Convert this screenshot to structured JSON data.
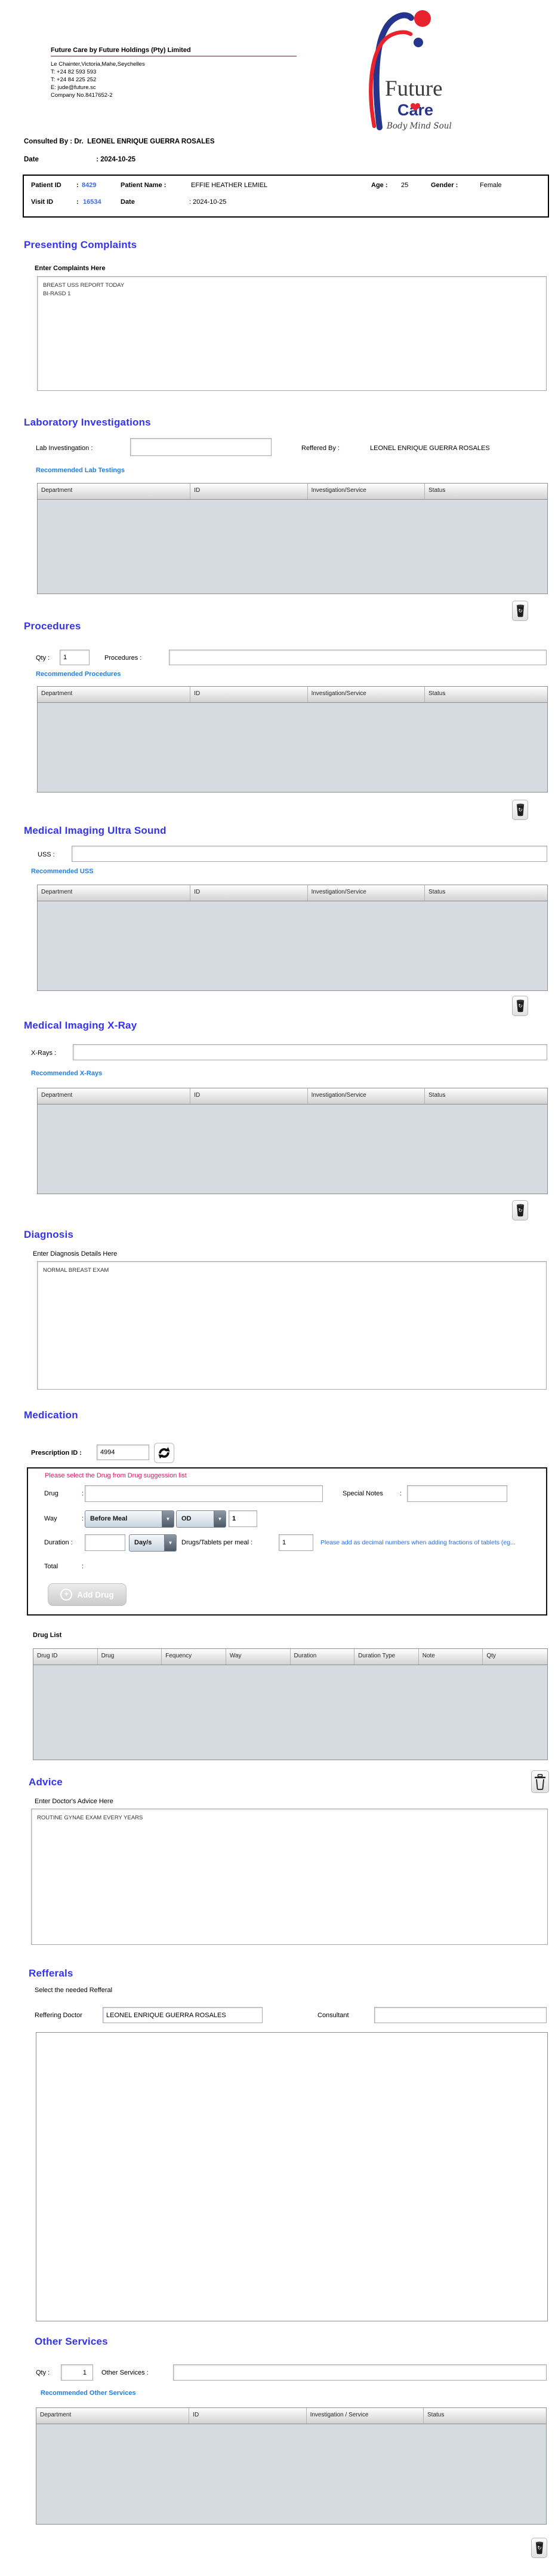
{
  "letterhead": {
    "company_title": "Future Care by Future Holdings (Pty) Limited",
    "address": "Le Chainter,Victoria,Mahe,Seychelles",
    "phone1": "T: +24  82 593 593",
    "phone2": "T: +24  84 225 252",
    "email": "E: jude@future.sc",
    "company_no": "Company No.8417652-2",
    "logo": {
      "word1": "Future",
      "word2": "Care",
      "tagline": "Body Mind Soul"
    }
  },
  "consultation": {
    "consulted_by_label": "Consulted By  :  Dr.",
    "consulted_by_name": "LEONEL ENRIQUE GUERRA ROSALES",
    "date_label": "Date",
    "date_value": ": 2024-10-25"
  },
  "patient": {
    "patient_id_label": "Patient ID",
    "colon": ":",
    "patient_id": "8429",
    "patient_name_label": "Patient Name :",
    "patient_name": "EFFIE HEATHER LEMIEL",
    "age_label": "Age :",
    "age": "25",
    "gender_label": "Gender  :",
    "gender": "Female",
    "visit_id_label": "Visit ID",
    "visit_id": "16534",
    "visit_date_label": "Date",
    "visit_date": ": 2024-10-25"
  },
  "presenting": {
    "title": "Presenting Complaints",
    "input_label": "Enter Complaints Here",
    "value": "BREAST USS REPORT TODAY\nBI-RASD 1"
  },
  "lab": {
    "title": "Laboratory  Investigations",
    "field_label": "Lab Investingation :",
    "referred_by_label": "Reffered By :",
    "referred_by": "LEONEL ENRIQUE GUERRA ROSALES",
    "link": "Recommended Lab Testings",
    "headers": [
      "Department",
      "ID",
      "Investigation/Service",
      "Status"
    ]
  },
  "procedures": {
    "title": "Procedures",
    "qty_label": "Qty :",
    "qty": "1",
    "field_label": "Procedures :",
    "link": "Recommended Procedures",
    "headers": [
      "Department",
      "ID",
      "Investigation/Service",
      "Status"
    ]
  },
  "uss": {
    "title": "Medical Imaging Ultra Sound",
    "field_label": "USS :",
    "link": "Recommended USS",
    "headers": [
      "Department",
      "ID",
      "Investigation/Service",
      "Status"
    ]
  },
  "xray": {
    "title": "Medical Imaging X-Ray",
    "field_label": "X-Rays :",
    "link": "Recommended X-Rays",
    "headers": [
      "Department",
      "ID",
      "Investigation/Service",
      "Status"
    ]
  },
  "diagnosis": {
    "title": "Diagnosis",
    "input_label": "Enter Diagnosis Details Here",
    "value": "NORMAL BREAST EXAM"
  },
  "medication": {
    "title": "Medication",
    "prescription_label": "Prescription ID :",
    "prescription_id": "4994",
    "warning": "Please select the Drug from Drug suggession list",
    "drug_label": "Drug",
    "colon": ":",
    "special_notes_label": "Special Notes",
    "way_label": "Way",
    "way_meal": "Before Meal",
    "way_freq": "OD",
    "way_qty": "1",
    "duration_label": "Duration :",
    "duration_unit": "Day/s",
    "per_meal_label": "Drugs/Tablets per meal :",
    "per_meal_qty": "1",
    "decimal_note": "Please add as decimal numbers when adding fractions of tablets (eg...",
    "total_label": "Total",
    "add_drug_label": "Add Drug",
    "drug_list_label": "Drug List",
    "drug_headers": [
      "Drug ID",
      "Drug",
      "Fequency",
      "Way",
      "Duration",
      "Duration Type",
      "Note",
      "Qty"
    ]
  },
  "advice": {
    "title": "Advice",
    "input_label": "Enter Doctor's Advice Here",
    "value": "ROUTINE GYNAE EXAM EVERY YEARS"
  },
  "refferals": {
    "title": "Refferals",
    "subtitle": "Select the needed Refferal",
    "reffering_doctor_label": "Reffering Doctor",
    "reffering_doctor": "LEONEL ENRIQUE GUERRA ROSALES",
    "consultant_label": "Consultant"
  },
  "other_services": {
    "title": "Other Services",
    "qty_label": "Qty :",
    "qty": "1",
    "field_label": "Other Services :",
    "link": "Recommended Other Services",
    "headers": [
      "Department",
      "ID",
      "Investigation / Service",
      "Status"
    ]
  }
}
